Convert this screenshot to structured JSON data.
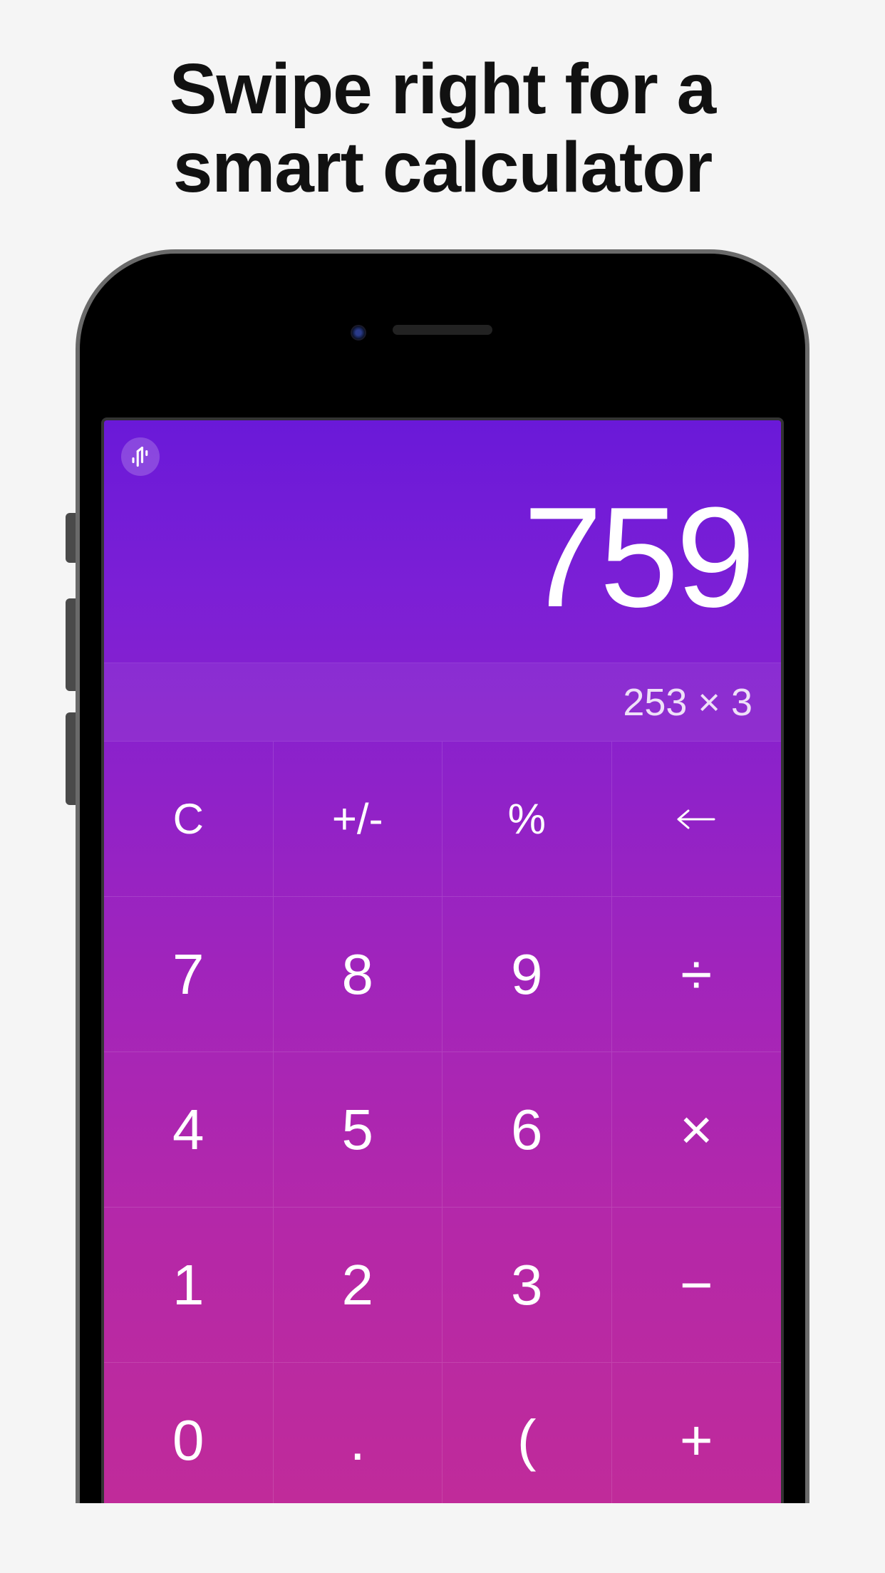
{
  "marketing": {
    "headline_line1": "Swipe right for a",
    "headline_line2": "smart calculator"
  },
  "calculator": {
    "result": "759",
    "history": "253 × 3",
    "icon": "waveform-icon"
  },
  "keys": {
    "row0": {
      "clear": "C",
      "sign": "+/-",
      "percent": "%",
      "backspace": "←"
    },
    "row1": {
      "d7": "7",
      "d8": "8",
      "d9": "9",
      "divide": "÷"
    },
    "row2": {
      "d4": "4",
      "d5": "5",
      "d6": "6",
      "multiply": "×"
    },
    "row3": {
      "d1": "1",
      "d2": "2",
      "d3": "3",
      "subtract": "−"
    },
    "row4": {
      "d0": "0",
      "decimal": ".",
      "lparen": "(",
      "add": "+"
    }
  }
}
